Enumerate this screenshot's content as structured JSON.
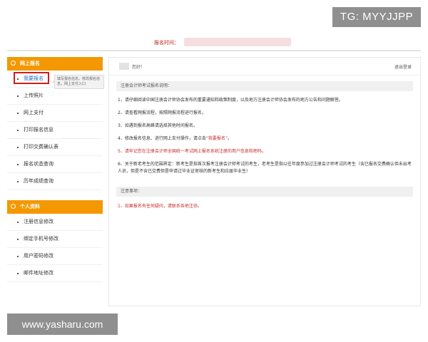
{
  "watermark_top": "TG: MYYJJPP",
  "watermark_bottom": "www.yasharu.com",
  "header": {
    "label": "报名时间："
  },
  "sidebar": {
    "online_section": "网上报名",
    "online_items": [
      {
        "label": "我要报名"
      },
      {
        "label": "上传照片"
      },
      {
        "label": "网上支付"
      },
      {
        "label": "打印报名信息"
      },
      {
        "label": "打印交费确认表"
      },
      {
        "label": "报名状态查询"
      },
      {
        "label": "历年成绩查询"
      }
    ],
    "personal_section": "个人资料",
    "personal_items": [
      {
        "label": "注册信息修改"
      },
      {
        "label": "绑定手机号修改"
      },
      {
        "label": "用户密码修改"
      },
      {
        "label": "邮件地址修改"
      }
    ],
    "tooltip": "填写报名信息，修改报名信息，网上支付入口"
  },
  "content": {
    "greeting": "您好！",
    "logout": "退出登录",
    "instructions_title": "注册会计师考试报名说明：",
    "items": [
      "1、请仔细阅读中国注册会计师协会发布的重要通知和政策制度，以及地方注册会计师协会发布的地方公告和问题解答。",
      "2、请查看网报流程，按照网报流程进行报名。",
      "3、如遇到报名高峰请选择其他时间报名。",
      "5、请牢记您在注册会计师全国统一考试网上报名系统注册的用户信息和密码。",
      "6、关于新老考生的范围界定：新考生是指首次报考注册会计师考试的考生，老考生是指以往年度参加过注册会计师考试的考生（含已报名交费确认但未出考人员，但是不含已交费但是申请过毕业证审核的新考生和应届毕业生）"
    ],
    "item4": {
      "prefix": "4、修改报名信息、进行网上支付操作，请点击",
      "highlight": "“我要报名”",
      "suffix": "。"
    },
    "notice_title": "注意事项：",
    "notice": "1、如果报名有任何疑问，请联系各地注协。"
  }
}
